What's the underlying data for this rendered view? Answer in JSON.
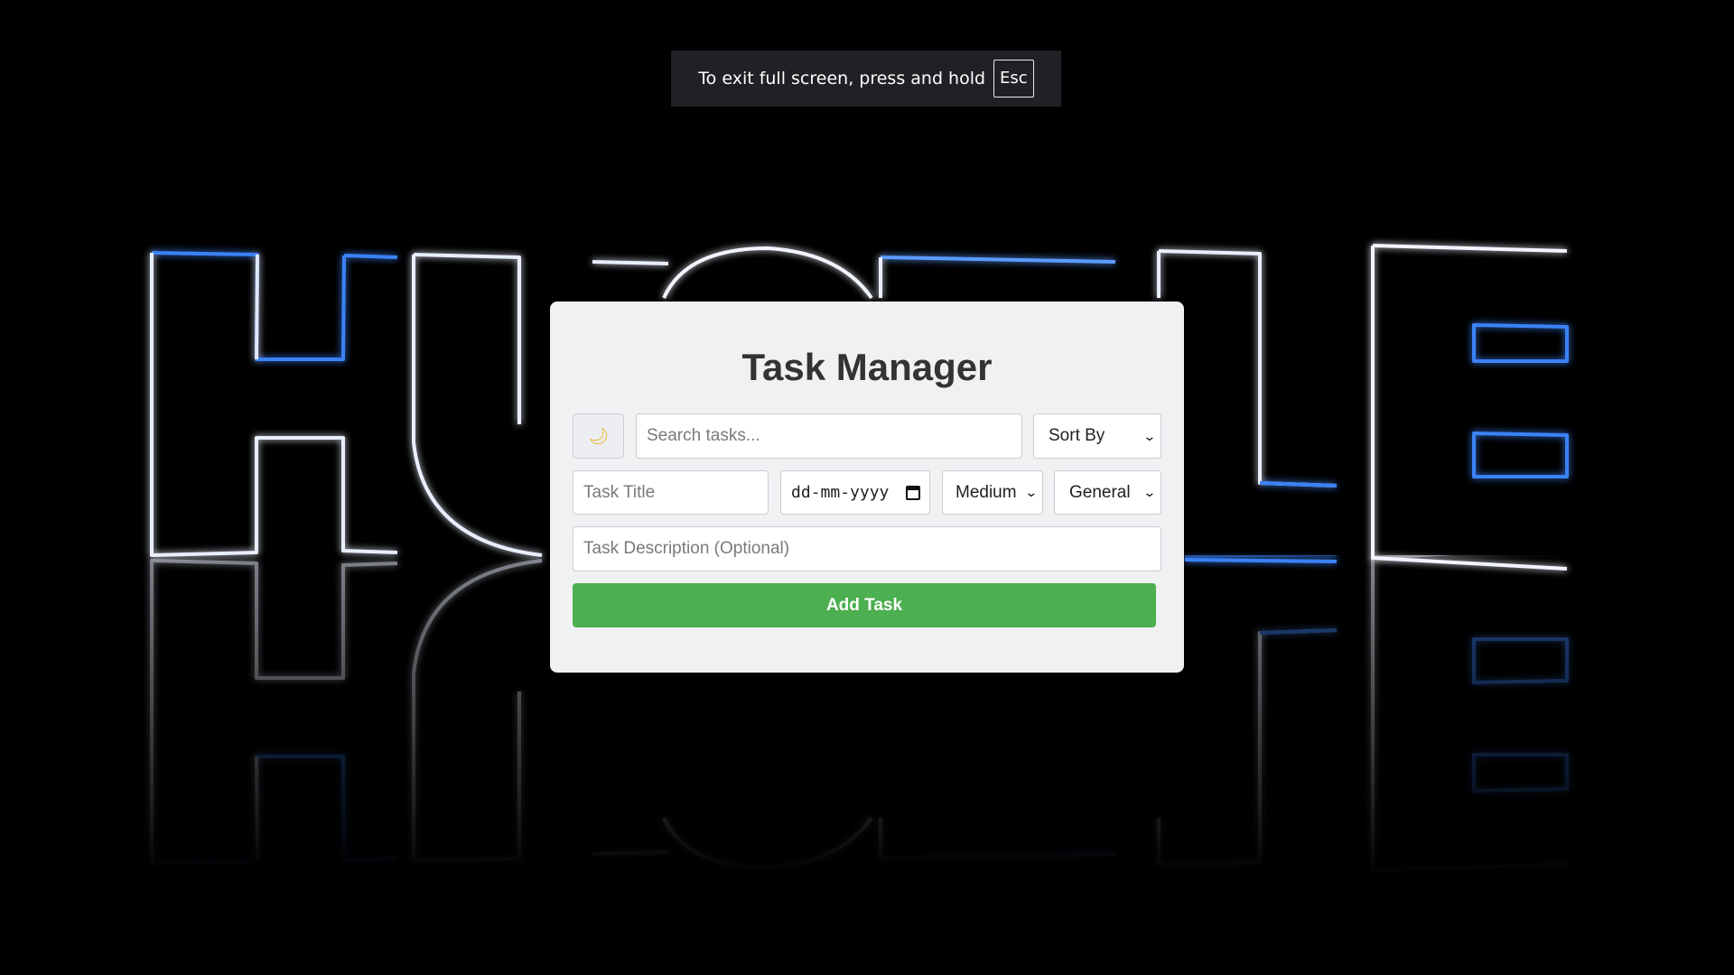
{
  "fullscreen_notice": {
    "text": "To exit full screen, press and hold",
    "key": "Esc"
  },
  "background": {
    "word": "HUSTLE"
  },
  "app": {
    "title": "Task Manager",
    "theme_toggle_icon": "moon-icon",
    "search": {
      "placeholder": "Search tasks...",
      "value": ""
    },
    "sort": {
      "selected": "Sort By"
    },
    "task_title": {
      "placeholder": "Task Title",
      "value": ""
    },
    "due_date": {
      "placeholder": "dd-mm-yyyy"
    },
    "priority": {
      "selected": "Medium"
    },
    "category": {
      "selected": "General"
    },
    "description": {
      "placeholder": "Task Description (Optional)",
      "value": ""
    },
    "add_button": "Add Task"
  },
  "colors": {
    "accent": "#4caf50",
    "card": "#f0f1f3",
    "neon": "#3b82f6"
  }
}
